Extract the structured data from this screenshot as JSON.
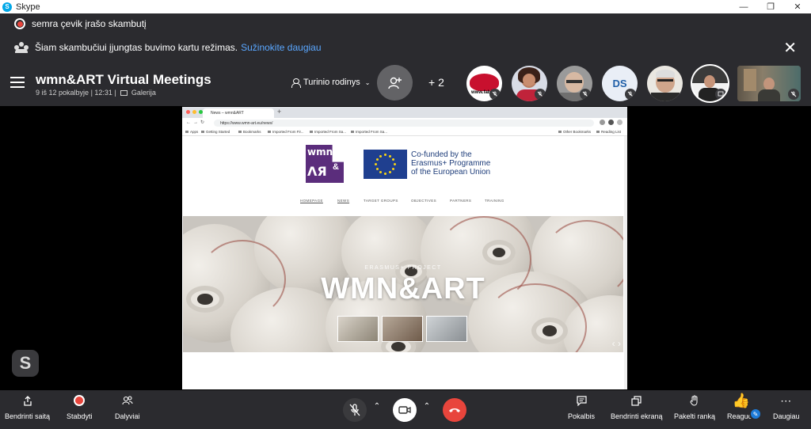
{
  "window": {
    "app_title": "Skype",
    "app_icon": "skype-icon",
    "controls": [
      "minimize-icon",
      "maximize-icon",
      "close-icon"
    ]
  },
  "recording_banner": {
    "text": "semra çevik įrašo skambutį"
  },
  "notice": {
    "text": "Šiam skambučiui įjungtas buvimo kartu režimas.",
    "link": "Sužinokite daugiau"
  },
  "header": {
    "title": "wmn&ART Virtual Meetings",
    "participants": "9 iš 12 pokalbyje",
    "duration": "12:31",
    "view_mode": "Galerija",
    "content_view_label": "Turinio rodinys",
    "extra_participants": "+ 2",
    "avatars": [
      {
        "kind": "logo",
        "label": "www.fabk"
      },
      {
        "kind": "photo"
      },
      {
        "kind": "photo"
      },
      {
        "kind": "initials",
        "initials": "DS"
      },
      {
        "kind": "photo"
      },
      {
        "kind": "photo"
      },
      {
        "kind": "video"
      }
    ]
  },
  "shared_screen": {
    "browser": {
      "tab_title": "News – wmn&ART",
      "url": "https://www.wmn-art.eu/news/",
      "bookmarks": [
        "Apps",
        "Getting Started",
        "Bookmarks",
        "Imported From Fir...",
        "Imported From Sa...",
        "Imported From Sa...",
        "Other Bookmarks",
        "Reading List"
      ]
    },
    "page": {
      "logo_top": "wmn",
      "logo_bottom": "ΛЯ",
      "logo_amp": "&",
      "eu_text_1": "Co-funded by the",
      "eu_text_2": "Erasmus+ Programme",
      "eu_text_3": "of the European Union",
      "nav": [
        "HOMEPAGE",
        "NEWS",
        "TARGET GROUPS",
        "OBJECTIVES",
        "PARTNERS",
        "TRAINING"
      ],
      "hero_kicker": "ERASMUS+ PROJECT",
      "hero_title": "WMN&ART"
    }
  },
  "toolbar": {
    "share_site": "Bendrinti saitą",
    "stop": "Stabdyti",
    "participants": "Dalyviai",
    "chat": "Pokalbis",
    "share_screen": "Bendrinti ekraną",
    "raise_hand": "Pakelti ranką",
    "react": "Reaguoti",
    "more": "Daugiau"
  },
  "colors": {
    "accent": "#1d7bd8",
    "end_call": "#e8453c",
    "recording": "#e8453c",
    "link": "#5aa7ff",
    "wmn_purple": "#5b2d7c",
    "eu_blue": "#1f3f8f"
  }
}
